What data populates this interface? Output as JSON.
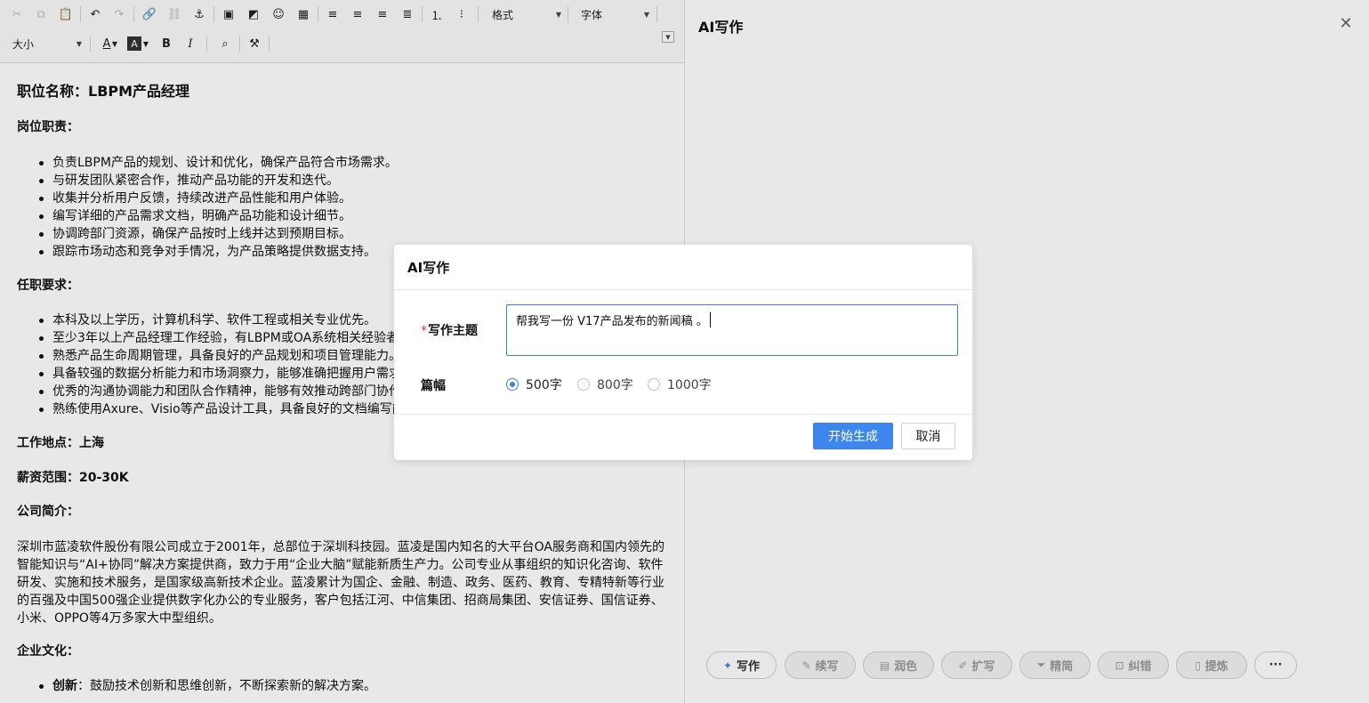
{
  "toolbar": {
    "format_label": "格式",
    "font_label": "字体",
    "size_label": "大小"
  },
  "document": {
    "title": "职位名称：LBPM产品经理",
    "duties_heading": "岗位职责：",
    "duties": [
      "负责LBPM产品的规划、设计和优化，确保产品符合市场需求。",
      "与研发团队紧密合作，推动产品功能的开发和迭代。",
      "收集并分析用户反馈，持续改进产品性能和用户体验。",
      "编写详细的产品需求文档，明确产品功能和设计细节。",
      "协调跨部门资源，确保产品按时上线并达到预期目标。",
      "跟踪市场动态和竞争对手情况，为产品策略提供数据支持。"
    ],
    "requirements_heading": "任职要求：",
    "requirements": [
      "本科及以上学历，计算机科学、软件工程或相关专业优先。",
      "至少3年以上产品经理工作经验，有LBPM或OA系统相关经验者",
      "熟悉产品生命周期管理，具备良好的产品规划和项目管理能力。",
      "具备较强的数据分析能力和市场洞察力，能够准确把握用户需求",
      "优秀的沟通协调能力和团队合作精神，能够有效推动跨部门协作",
      "熟练使用Axure、Visio等产品设计工具，具备良好的文档编写能"
    ],
    "location": "工作地点：上海",
    "salary": "薪资范围：20-30K",
    "company_heading": "公司简介：",
    "company_text": "深圳市蓝凌软件股份有限公司成立于2001年，总部位于深圳科技园。蓝凌是国内知名的大平台OA服务商和国内领先的智能知识与“AI+协同”解决方案提供商，致力于用“企业大脑”赋能新质生产力。公司专业从事组织的知识化咨询、软件研发、实施和技术服务，是国家级高新技术企业。蓝凌累计为国企、金融、制造、政务、医药、教育、专精特新等行业的百强及中国500强企业提供数字化办公的专业服务，客户包括江河、中信集团、招商局集团、安信证券、国信证券、小米、OPPO等4万多家大中型组织。",
    "culture_heading": "企业文化：",
    "culture_item_term": "创新",
    "culture_item_text": "：鼓励技术创新和思维创新，不断探索新的解决方案。"
  },
  "panel": {
    "title": "AI写作",
    "actions": [
      {
        "label": "写作",
        "icon": "magic-wand-icon",
        "enabled": true
      },
      {
        "label": "续写",
        "icon": "doc-edit-icon",
        "enabled": false
      },
      {
        "label": "润色",
        "icon": "doc-icon",
        "enabled": false
      },
      {
        "label": "扩写",
        "icon": "pen-icon",
        "enabled": false
      },
      {
        "label": "精简",
        "icon": "funnel-icon",
        "enabled": false
      },
      {
        "label": "纠错",
        "icon": "check-icon",
        "enabled": false
      },
      {
        "label": "提炼",
        "icon": "note-icon",
        "enabled": false
      },
      {
        "label": "···",
        "icon": "more-icon",
        "enabled": true
      }
    ]
  },
  "dialog": {
    "title": "AI写作",
    "topic_label": "写作主题",
    "topic_required": "*",
    "topic_value": "帮我写一份 V17产品发布的新闻稿 。",
    "length_label": "篇幅",
    "length_options": [
      "500字",
      "800字",
      "1000字"
    ],
    "length_selected": "500字",
    "submit_label": "开始生成",
    "cancel_label": "取消"
  },
  "colors": {
    "accent": "#3d86ee",
    "required": "#e53935"
  }
}
